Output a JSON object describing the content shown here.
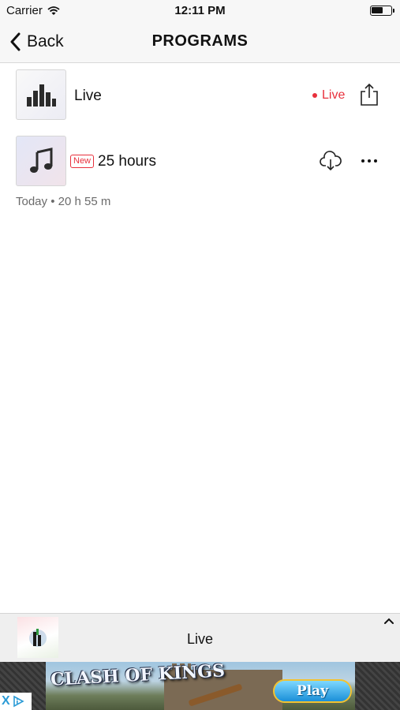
{
  "status_bar": {
    "carrier": "Carrier",
    "time": "12:11 PM"
  },
  "nav": {
    "back_label": "Back",
    "title": "PROGRAMS"
  },
  "programs": [
    {
      "title": "Live",
      "status": "Live",
      "thumbnail_icon": "equalizer-bars-icon",
      "action_icon": "share-icon"
    },
    {
      "title": "25 hours",
      "badge": "New",
      "meta": "Today • 20 h 55 m",
      "thumbnail_icon": "music-note-icon",
      "action_icons": [
        "cloud-download-icon",
        "more-icon"
      ]
    }
  ],
  "mini_player": {
    "title": "Live",
    "expand_icon": "chevron-up-icon"
  },
  "ad": {
    "logo_text": "CLASH OF KINGS",
    "cta_label": "Play",
    "close_glyph": "X",
    "info_icon": "ad-choices-icon"
  },
  "colors": {
    "accent_red": "#e8303c",
    "bar_background": "#f7f7f7",
    "meta_text": "#6b6b6b"
  }
}
